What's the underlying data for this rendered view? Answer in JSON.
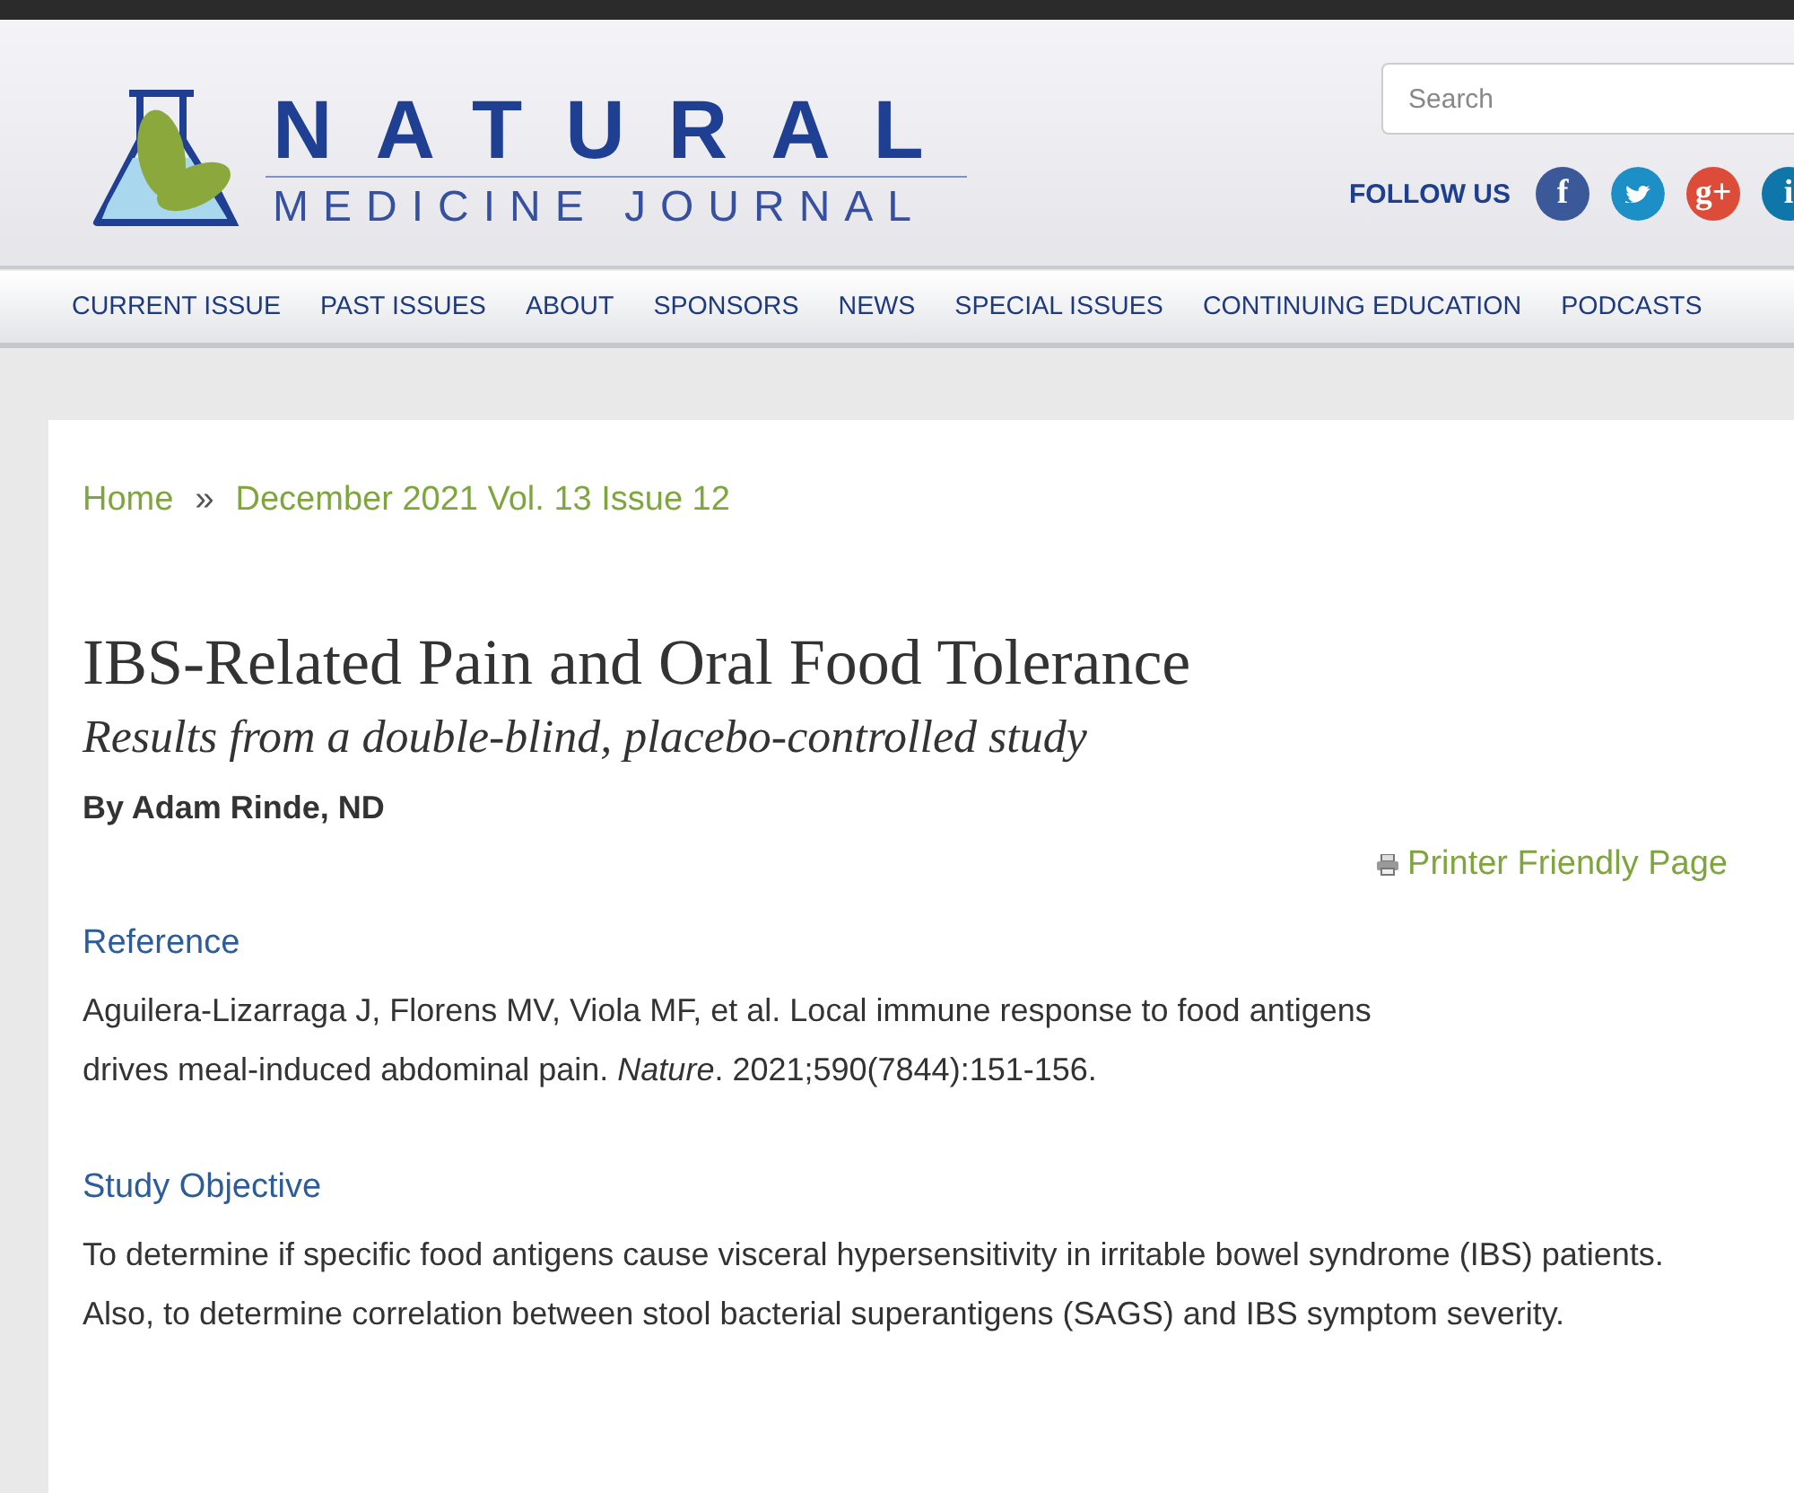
{
  "header": {
    "logo": {
      "word_1": "NATURAL",
      "word_2": "MEDICINE JOURNAL"
    },
    "search": {
      "placeholder": "Search"
    },
    "follow_label": "FOLLOW US",
    "social": [
      {
        "kind": "glyph",
        "glyph": "f",
        "color": "#3b5998"
      },
      {
        "kind": "bird",
        "color": "#1d8fc7"
      },
      {
        "kind": "glyph",
        "glyph": "g+",
        "color": "#dd4b39"
      },
      {
        "kind": "glyph",
        "glyph": "i",
        "color": "#0e76a8"
      }
    ]
  },
  "nav": [
    "CURRENT ISSUE",
    "PAST ISSUES",
    "ABOUT",
    "SPONSORS",
    "NEWS",
    "SPECIAL ISSUES",
    "CONTINUING EDUCATION",
    "PODCASTS"
  ],
  "breadcrumb": {
    "items": [
      "Home",
      "December 2021 Vol. 13 Issue 12"
    ],
    "separator": "»"
  },
  "article": {
    "title": "IBS-Related Pain and Oral Food Tolerance",
    "subtitle": "Results from a double-blind, placebo-controlled study",
    "byline": "By Adam Rinde, ND",
    "printer_link": "Printer Friendly Page",
    "sections": [
      {
        "heading": "Reference",
        "lines": [
          "Aguilera-Lizarraga J, Florens MV, Viola MF, et al. Local immune response to food antigens",
          "drives meal-induced abdominal pain. *Nature*. 2021;590(7844):151-156."
        ]
      },
      {
        "heading": "Study Objective",
        "lines": [
          "To determine if specific food antigens cause visceral hypersensitivity in irritable bowel syndrome (IBS) patients. Also, to determine correlation between stool bacterial superantigens (SAGS) and IBS symptom severity."
        ]
      }
    ]
  }
}
